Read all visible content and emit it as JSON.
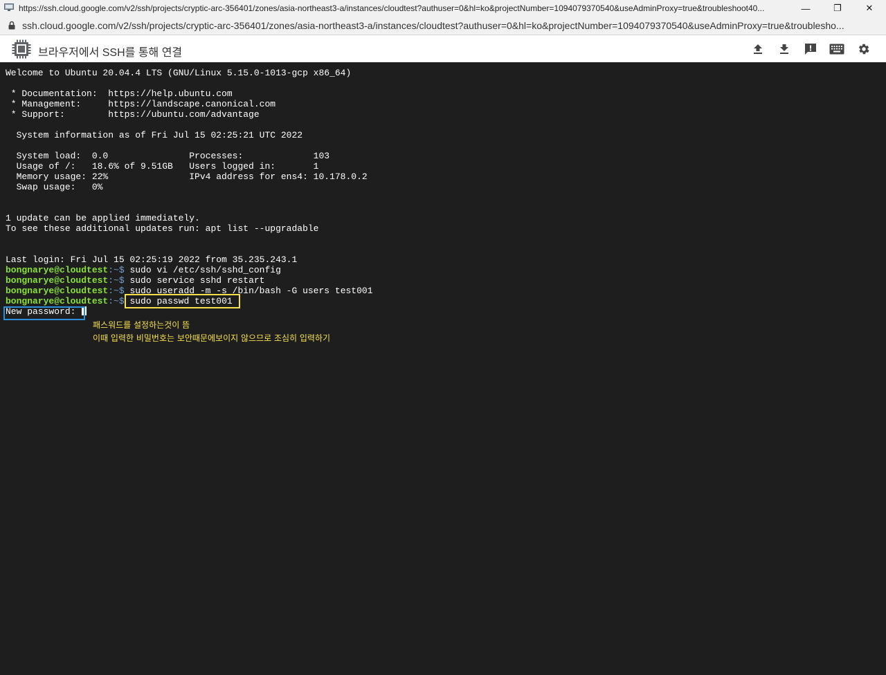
{
  "window": {
    "title": "https://ssh.cloud.google.com/v2/ssh/projects/cryptic-arc-356401/zones/asia-northeast3-a/instances/cloudtest?authuser=0&hl=ko&projectNumber=1094079370540&useAdminProxy=true&troubleshoot40...",
    "minimize_glyph": "—",
    "maximize_glyph": "❐",
    "close_glyph": "✕"
  },
  "address": {
    "url": "ssh.cloud.google.com/v2/ssh/projects/cryptic-arc-356401/zones/asia-northeast3-a/instances/cloudtest?authuser=0&hl=ko&projectNumber=1094079370540&useAdminProxy=true&troublesho..."
  },
  "toolbar": {
    "title": "브라우저에서 SSH를 통해 연결",
    "icons": [
      "upload-icon",
      "download-icon",
      "feedback-icon",
      "keyboard-icon",
      "settings-icon"
    ]
  },
  "terminal": {
    "lines": [
      "Welcome to Ubuntu 20.04.4 LTS (GNU/Linux 5.15.0-1013-gcp x86_64)",
      " * Documentation:  https://help.ubuntu.com",
      " * Management:     https://landscape.canonical.com",
      " * Support:        https://ubuntu.com/advantage",
      "  System information as of Fri Jul 15 02:25:21 UTC 2022",
      "  System load:  0.0               Processes:             103",
      "  Usage of /:   18.6% of 9.51GB   Users logged in:       1",
      "  Memory usage: 22%               IPv4 address for ens4: 10.178.0.2",
      "  Swap usage:   0%",
      "1 update can be applied immediately.",
      "To see these additional updates run: apt list --upgradable",
      "Last login: Fri Jul 15 02:25:19 2022 from 35.235.243.1"
    ],
    "prompt_user": "bongnarye@cloudtest",
    "prompt_sep": ":~$",
    "commands": [
      " sudo vi /etc/ssh/sshd_config",
      " sudo service sshd restart",
      " sudo useradd -m -s /bin/bash -G users test001",
      " sudo passwd test001"
    ],
    "password_prompt": "New password: "
  },
  "annotation": {
    "line1": "패스워드를 설정하는것이 뜸",
    "line2": "이때 입력한 비밀번호는 보안때문에보이지 않으므로 조심히 입력하기"
  },
  "colors": {
    "terminal_bg": "#1e1e1e",
    "prompt_green": "#89e234",
    "prompt_blue": "#729fcf",
    "highlight_yellow": "#f7e14b",
    "highlight_blue": "#2a8fd8"
  }
}
